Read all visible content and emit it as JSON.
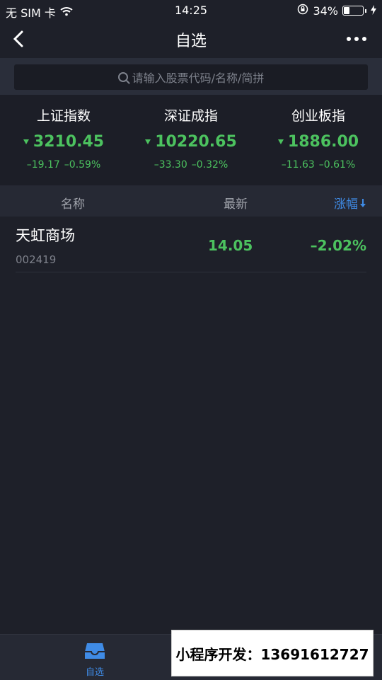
{
  "status_bar": {
    "carrier": "无 SIM 卡",
    "time": "14:25",
    "battery": "34%",
    "battery_level": 0.34
  },
  "nav": {
    "title": "自选",
    "back_icon": "chevron-left-icon",
    "more_icon": "more-icon"
  },
  "search": {
    "placeholder": "请输入股票代码/名称/简拼"
  },
  "indices": [
    {
      "name": "上证指数",
      "value": "3210.45",
      "change": "–19.17",
      "change_pct": "–0.59%"
    },
    {
      "name": "深证成指",
      "value": "10220.65",
      "change": "–33.30",
      "change_pct": "–0.32%"
    },
    {
      "name": "创业板指",
      "value": "1886.00",
      "change": "–11.63",
      "change_pct": "–0.61%"
    }
  ],
  "table": {
    "headers": {
      "name": "名称",
      "latest": "最新",
      "change": "涨幅"
    },
    "rows": [
      {
        "name": "天虹商场",
        "code": "002419",
        "price": "14.05",
        "change_pct": "–2.02%"
      }
    ]
  },
  "tabbar": {
    "items": [
      {
        "label": "自选",
        "icon": "inbox-icon",
        "active": true
      }
    ]
  },
  "ad": {
    "text": "小程序开发：13691612727"
  },
  "colors": {
    "background": "#1e2029",
    "down_green": "#4cc25f",
    "accent_blue": "#3f8be6"
  }
}
